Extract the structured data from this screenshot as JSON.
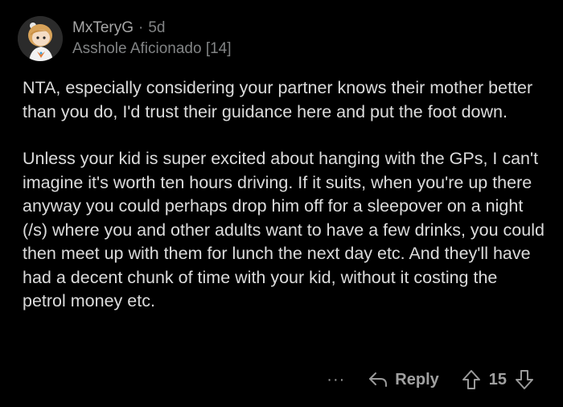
{
  "comment": {
    "author": "MxTeryG",
    "separator": "·",
    "age": "5d",
    "flair": "Asshole Aficionado [14]",
    "paragraphs": [
      "NTA, especially considering your partner knows their mother better than you do, I'd trust their guidance here and put the foot down.",
      "Unless your kid is super excited about hanging with the GPs, I can't imagine it's worth ten hours driving. If it suits, when you're up there anyway you could perhaps drop him off for a sleepover on a night (/s) where you and other adults want to have a few drinks, you could then meet up with them for lunch the next day etc. And they'll have had a decent chunk of time with your kid, without it costing the petrol money etc."
    ],
    "actions": {
      "more_label": "···",
      "reply_label": "Reply",
      "vote_count": "15"
    }
  },
  "icons": {
    "more": "more-icon",
    "reply": "reply-arrow-icon",
    "upvote": "upvote-arrow-icon",
    "downvote": "downvote-arrow-icon"
  },
  "colors": {
    "background": "#000000",
    "text": "#dcdcdc",
    "muted": "#818384"
  }
}
